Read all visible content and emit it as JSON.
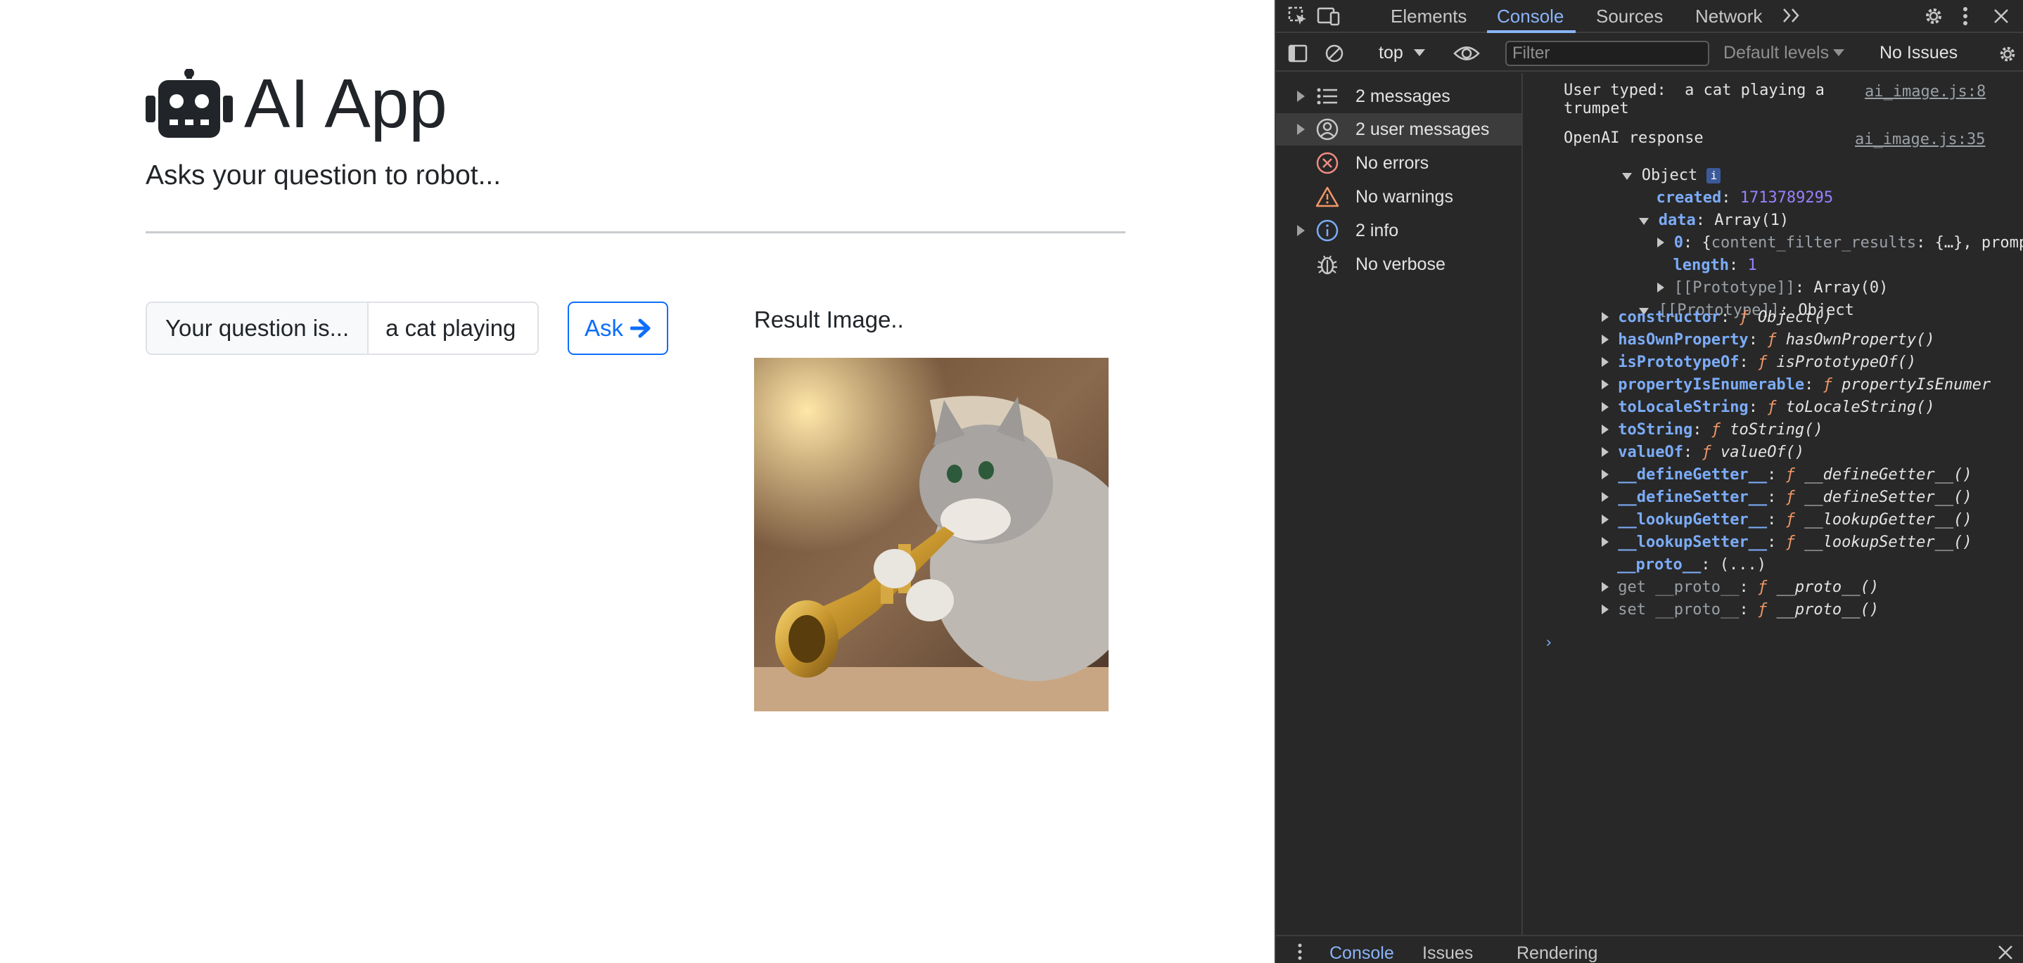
{
  "app": {
    "title": "AI App",
    "subtitle": "Asks your question to robot...",
    "input_label": "Your question is...",
    "input_value": "a cat playing",
    "ask_label": "Ask",
    "result_label": "Result Image.."
  },
  "devtools": {
    "tabs": [
      "Elements",
      "Console",
      "Sources",
      "Network"
    ],
    "active_tab": "Console",
    "toolbar": {
      "context": "top",
      "filter_placeholder": "Filter",
      "levels": "Default levels",
      "issues": "No Issues"
    },
    "sidebar": [
      {
        "label": "2 messages",
        "icon": "list-icon",
        "expandable": true
      },
      {
        "label": "2 user messages",
        "icon": "user-icon",
        "expandable": true,
        "selected": true
      },
      {
        "label": "No errors",
        "icon": "error-icon",
        "expandable": false
      },
      {
        "label": "No warnings",
        "icon": "warning-icon",
        "expandable": false
      },
      {
        "label": "2 info",
        "icon": "info-icon",
        "expandable": true
      },
      {
        "label": "No verbose",
        "icon": "bug-icon",
        "expandable": false
      }
    ],
    "console": {
      "log1_line1": "User typed:  a cat playing a",
      "log1_line2": "trumpet",
      "log1_source": "ai_image.js:8",
      "log2_text": "OpenAI response",
      "log2_source": "ai_image.js:35",
      "object_label": "Object",
      "created_key": "created",
      "created_value": "1713789295",
      "data_key": "data",
      "data_value": "Array(1)",
      "item0_key": "0",
      "item0_value_a": "content_filter_results",
      "item0_value_b": "{…}, prompt_",
      "length_key": "length",
      "length_value": "1",
      "proto_array_key": "[[Prototype]]",
      "proto_array_value": "Array(0)",
      "proto_obj_key": "[[Prototype]]",
      "proto_obj_value": "Object",
      "methods": [
        {
          "key": "constructor",
          "fn": "Object()"
        },
        {
          "key": "hasOwnProperty",
          "fn": "hasOwnProperty()"
        },
        {
          "key": "isPrototypeOf",
          "fn": "isPrototypeOf()"
        },
        {
          "key": "propertyIsEnumerable",
          "fn": "propertyIsEnumer"
        },
        {
          "key": "toLocaleString",
          "fn": "toLocaleString()"
        },
        {
          "key": "toString",
          "fn": "toString()"
        },
        {
          "key": "valueOf",
          "fn": "valueOf()"
        },
        {
          "key": "__defineGetter__",
          "fn": "__defineGetter__()"
        },
        {
          "key": "__defineSetter__",
          "fn": "__defineSetter__()"
        },
        {
          "key": "__lookupGetter__",
          "fn": "__lookupGetter__()"
        },
        {
          "key": "__lookupSetter__",
          "fn": "__lookupSetter__()"
        }
      ],
      "proto_getter_key": "__proto__",
      "proto_getter_value": "(...)",
      "get_proto_key": "get __proto__",
      "get_proto_fn": "__proto__()",
      "set_proto_key": "set __proto__",
      "set_proto_fn": "__proto__()"
    },
    "drawer_tabs": [
      "Console",
      "Issues",
      "Rendering"
    ]
  }
}
